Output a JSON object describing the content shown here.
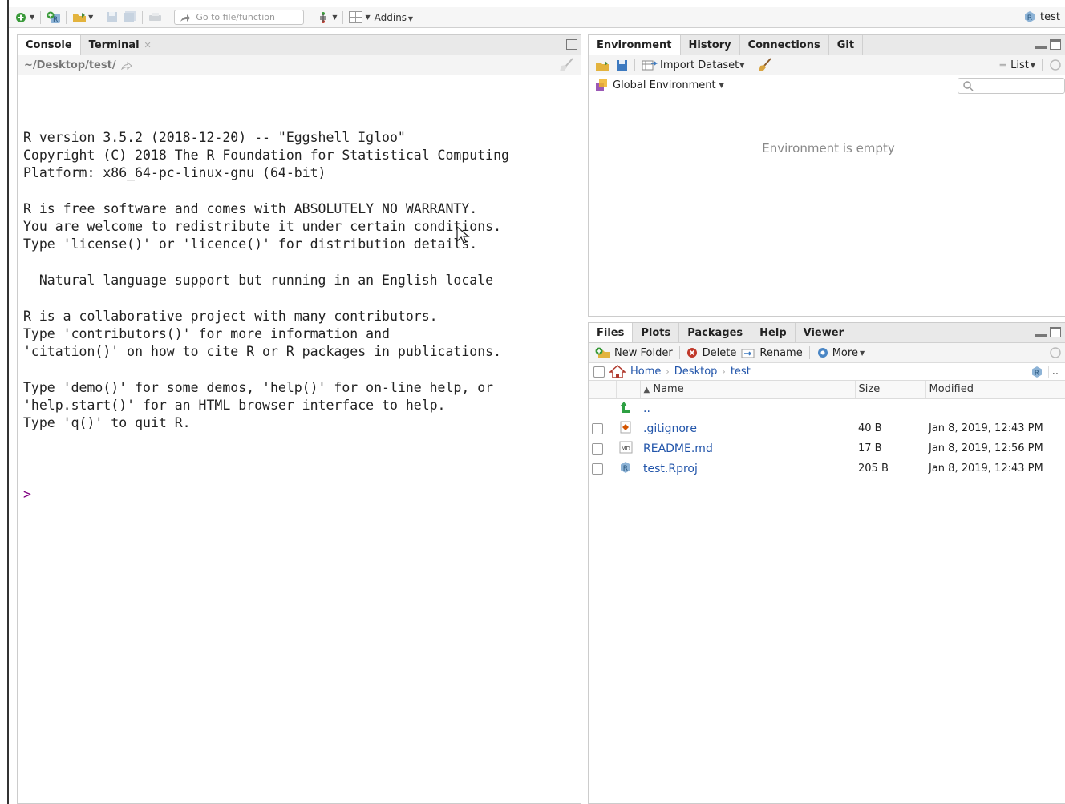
{
  "toolbar": {
    "goto_placeholder": "Go to file/function",
    "addins_label": "Addins",
    "project_name": "test"
  },
  "console_pane": {
    "tabs": [
      {
        "label": "Console",
        "active": true
      },
      {
        "label": "Terminal",
        "active": false,
        "closable": true
      }
    ],
    "path": "~/Desktop/test/",
    "lines": [
      "R version 3.5.2 (2018-12-20) -- \"Eggshell Igloo\"",
      "Copyright (C) 2018 The R Foundation for Statistical Computing",
      "Platform: x86_64-pc-linux-gnu (64-bit)",
      "",
      "R is free software and comes with ABSOLUTELY NO WARRANTY.",
      "You are welcome to redistribute it under certain conditions.",
      "Type 'license()' or 'licence()' for distribution details.",
      "",
      "  Natural language support but running in an English locale",
      "",
      "R is a collaborative project with many contributors.",
      "Type 'contributors()' for more information and",
      "'citation()' on how to cite R or R packages in publications.",
      "",
      "Type 'demo()' for some demos, 'help()' for on-line help, or",
      "'help.start()' for an HTML browser interface to help.",
      "Type 'q()' to quit R."
    ],
    "prompt": ">"
  },
  "env_pane": {
    "tabs": [
      {
        "label": "Environment",
        "active": true
      },
      {
        "label": "History",
        "active": false
      },
      {
        "label": "Connections",
        "active": false
      },
      {
        "label": "Git",
        "active": false
      }
    ],
    "import_label": "Import Dataset",
    "view_mode": "List",
    "scope_label": "Global Environment",
    "empty_message": "Environment is empty"
  },
  "files_pane": {
    "tabs": [
      {
        "label": "Files",
        "active": true
      },
      {
        "label": "Plots",
        "active": false
      },
      {
        "label": "Packages",
        "active": false
      },
      {
        "label": "Help",
        "active": false
      },
      {
        "label": "Viewer",
        "active": false
      }
    ],
    "actions": {
      "new_folder": "New Folder",
      "delete": "Delete",
      "rename": "Rename",
      "more": "More"
    },
    "breadcrumb": [
      "Home",
      "Desktop",
      "test"
    ],
    "overflow_label": "..",
    "columns": {
      "name": "Name",
      "size": "Size",
      "modified": "Modified"
    },
    "parent_label": "..",
    "files": [
      {
        "name": ".gitignore",
        "size": "40 B",
        "modified": "Jan 8, 2019, 12:43 PM",
        "icon": "git-file-icon"
      },
      {
        "name": "README.md",
        "size": "17 B",
        "modified": "Jan 8, 2019, 12:56 PM",
        "icon": "markdown-file-icon"
      },
      {
        "name": "test.Rproj",
        "size": "205 B",
        "modified": "Jan 8, 2019, 12:43 PM",
        "icon": "rproj-file-icon"
      }
    ]
  }
}
